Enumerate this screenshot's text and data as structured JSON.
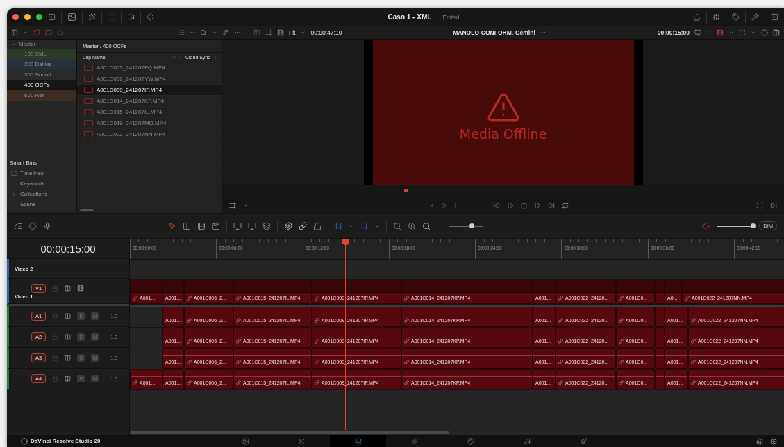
{
  "window": {
    "title": "Caso 1 - XML",
    "status": "Edited"
  },
  "toolbar": {
    "zoom": "Fit",
    "source_timecode": "00:00:47:10",
    "timeline_name": "MANOLO-CONFORM.-Gemini",
    "record_timecode": "00:00:15:00"
  },
  "bins": {
    "root": "Master",
    "expanded": true,
    "children": [
      {
        "label": "100 XML",
        "color": "#2e3a29",
        "selected": false
      },
      {
        "label": "200 Dailies",
        "color": "#26313c",
        "selected": false
      },
      {
        "label": "300 Sound",
        "color": "#2a2a2b",
        "selected": false
      },
      {
        "label": "400 OCFs",
        "color": "#151515",
        "selected": true
      },
      {
        "label": "600 Ref",
        "color": "#3d2c22",
        "selected": false
      }
    ]
  },
  "smart_bins": {
    "title": "Smart Bins",
    "items": [
      {
        "label": "Timelines",
        "kind": "timelines"
      },
      {
        "label": "Keywords",
        "kind": "plain"
      },
      {
        "label": "Collections",
        "kind": "group"
      },
      {
        "label": "Scene",
        "kind": "plain"
      }
    ]
  },
  "media_pool": {
    "path": "Master / 400 OCFs",
    "columns": [
      "Clip Name",
      "Cloud Sync"
    ],
    "clips": [
      {
        "name": "A001C003_241207FQ.MP4",
        "selected": false
      },
      {
        "name": "A001C006_241207YW.MP4",
        "selected": false
      },
      {
        "name": "A001C009_241207IP.MP4",
        "selected": true
      },
      {
        "name": "A001C014_241207KP.MP4",
        "selected": false
      },
      {
        "name": "A001C015_241207IL.MP4",
        "selected": false
      },
      {
        "name": "A001C019_241207MQ.MP4",
        "selected": false
      },
      {
        "name": "A001C022_241207NN.MP4",
        "selected": false
      }
    ]
  },
  "viewer": {
    "message": "Media Offline",
    "scrubber": {
      "level": 0.32
    }
  },
  "timeline": {
    "timecode": "00:00:15:00",
    "ruler": [
      "00:00:00:00",
      "00:00:06:00",
      "00:00:12:00",
      "00:00:18:00",
      "00:00:24:00",
      "00:00:30:00",
      "00:00:36:00",
      "00:00:42:00"
    ],
    "zoom_slider": {
      "level": 0.68
    },
    "volume": {
      "level": 1
    },
    "muted": true,
    "dim": "DIM",
    "tracks": [
      {
        "kind": "video",
        "name": "Video 2"
      },
      {
        "kind": "video",
        "badge": "V1",
        "name": "Video 1",
        "clips": [
          {
            "kind": "clip",
            "label": "A001...",
            "linked": true
          },
          {
            "kind": "clip",
            "label": "A001...",
            "linked": false
          },
          {
            "kind": "clip",
            "label": "A001C006_2...",
            "linked": true
          },
          {
            "kind": "clip",
            "label": "A001C015_241207IL.MP4",
            "linked": true
          },
          {
            "kind": "clip",
            "label": "A001C009_241207IP.MP4",
            "linked": true
          },
          {
            "kind": "clip",
            "label": "A001C014_241207KP.MP4",
            "linked": true
          },
          {
            "kind": "clip",
            "label": "A001...",
            "linked": false
          },
          {
            "kind": "clip",
            "label": "A001C022_24120...",
            "linked": true
          },
          {
            "kind": "clip",
            "label": "A001C0...",
            "linked": true
          },
          {
            "kind": "clip",
            "linked": false
          },
          {
            "kind": "clip",
            "label": "A0...",
            "linked": false
          },
          {
            "kind": "clip",
            "label": "A001C022_241207NN.MP4",
            "linked": true
          }
        ]
      },
      {
        "kind": "audio",
        "badge": "A1",
        "solo": "S",
        "mute": "M",
        "gain": "1.0",
        "clips": [
          {
            "kind": "gap"
          },
          {
            "kind": "clip",
            "label": "A001...",
            "linked": false
          },
          {
            "kind": "clip",
            "label": "A001C006_2...",
            "linked": true
          },
          {
            "kind": "clip",
            "label": "A001C015_241207IL.MP4",
            "linked": true
          },
          {
            "kind": "clip",
            "label": "A001C009_241207IP.MP4",
            "linked": true
          },
          {
            "kind": "clip",
            "label": "A001C014_241207KP.MP4",
            "linked": true
          },
          {
            "kind": "clip",
            "label": "A001...",
            "linked": false
          },
          {
            "kind": "clip",
            "label": "A001C022_24120...",
            "linked": true
          },
          {
            "kind": "clip",
            "label": "A001C0...",
            "linked": true
          },
          {
            "kind": "clip",
            "linked": false
          },
          {
            "kind": "clip",
            "label": "A001...",
            "linked": false
          },
          {
            "kind": "clip",
            "label": "A001C022_241207NN.MP4",
            "linked": true
          }
        ]
      },
      {
        "kind": "audio",
        "badge": "A2",
        "solo": "S",
        "mute": "M",
        "gain": "1.0",
        "clips": [
          {
            "kind": "gap"
          },
          {
            "kind": "clip",
            "label": "A001...",
            "linked": false
          },
          {
            "kind": "clip",
            "label": "A001C006_2...",
            "linked": true
          },
          {
            "kind": "clip",
            "label": "A001C015_241207IL.MP4",
            "linked": true
          },
          {
            "kind": "clip",
            "label": "A001C009_241207IP.MP4",
            "linked": true
          },
          {
            "kind": "clip",
            "label": "A001C014_241207KP.MP4",
            "linked": true
          },
          {
            "kind": "clip",
            "label": "A001...",
            "linked": false
          },
          {
            "kind": "clip",
            "label": "A001C022_24120...",
            "linked": true
          },
          {
            "kind": "clip",
            "label": "A001C0...",
            "linked": true
          },
          {
            "kind": "clip",
            "linked": false
          },
          {
            "kind": "clip",
            "label": "A001...",
            "linked": false
          },
          {
            "kind": "clip",
            "label": "A001C022_241207NN.MP4",
            "linked": true
          }
        ]
      },
      {
        "kind": "audio",
        "badge": "A3",
        "solo": "S",
        "mute": "M",
        "gain": "1.0",
        "clips": [
          {
            "kind": "gap"
          },
          {
            "kind": "clip",
            "label": "A001...",
            "linked": false
          },
          {
            "kind": "clip",
            "label": "A001C006_2...",
            "linked": true
          },
          {
            "kind": "clip",
            "label": "A001C015_241207IL.MP4",
            "linked": true
          },
          {
            "kind": "clip",
            "label": "A001C009_241207IP.MP4",
            "linked": true
          },
          {
            "kind": "clip",
            "label": "A001C014_241207KP.MP4",
            "linked": true
          },
          {
            "kind": "clip",
            "label": "A001...",
            "linked": false
          },
          {
            "kind": "clip",
            "label": "A001C022_24120...",
            "linked": true
          },
          {
            "kind": "clip",
            "label": "A001C0...",
            "linked": true
          },
          {
            "kind": "clip",
            "linked": false
          },
          {
            "kind": "clip",
            "label": "A001...",
            "linked": false
          },
          {
            "kind": "clip",
            "label": "A001C022_241207NN.MP4",
            "linked": true
          }
        ]
      },
      {
        "kind": "audio",
        "badge": "A4",
        "solo": "S",
        "mute": "M",
        "gain": "1.0",
        "clips": [
          {
            "kind": "clip",
            "label": "A001...",
            "linked": true
          },
          {
            "kind": "clip",
            "label": "A001...",
            "linked": false
          },
          {
            "kind": "clip",
            "label": "A001C006_2...",
            "linked": true
          },
          {
            "kind": "clip",
            "label": "A001C015_241207IL.MP4",
            "linked": true
          },
          {
            "kind": "clip",
            "label": "A001C009_241207IP.MP4",
            "linked": true
          },
          {
            "kind": "clip",
            "label": "A001C014_241207KP.MP4",
            "linked": true
          },
          {
            "kind": "clip",
            "label": "A001...",
            "linked": false
          },
          {
            "kind": "clip",
            "label": "A001C022_24120...",
            "linked": true
          },
          {
            "kind": "clip",
            "label": "A001C0...",
            "linked": true
          },
          {
            "kind": "clip",
            "linked": false
          },
          {
            "kind": "clip",
            "label": "A001...",
            "linked": false
          },
          {
            "kind": "clip",
            "label": "A001C022_241207NN.MP4",
            "linked": true
          }
        ]
      }
    ]
  },
  "pages": {
    "app_name": "DaVinci Resolve Studio 20",
    "items": [
      {
        "kind": "media",
        "selected": false
      },
      {
        "kind": "cut",
        "selected": false
      },
      {
        "kind": "edit",
        "selected": true
      },
      {
        "kind": "fusion",
        "selected": false
      },
      {
        "kind": "color",
        "selected": false
      },
      {
        "kind": "fairlight",
        "selected": false
      },
      {
        "kind": "deliver",
        "selected": false
      }
    ]
  }
}
